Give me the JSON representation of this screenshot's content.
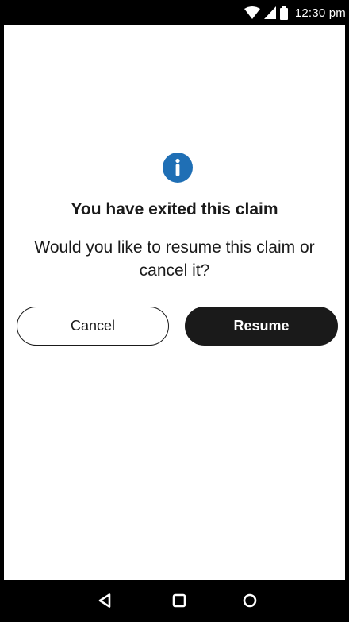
{
  "status_bar": {
    "time": "12:30 pm",
    "icons": [
      "wifi-icon",
      "cellular-signal-icon",
      "battery-icon"
    ]
  },
  "dialog": {
    "icon": "info-icon",
    "title": "You have exited this claim",
    "message": "Would you like to resume this claim or cancel it?",
    "cancel_label": "Cancel",
    "resume_label": "Resume"
  },
  "nav_bar": {
    "icons": [
      "back-icon",
      "home-icon",
      "recents-icon"
    ]
  },
  "colors": {
    "accent_info": "#1F6FB5",
    "primary_button": "#1A1A1A",
    "text": "#1A1A1A",
    "background": "#FFFFFF"
  }
}
